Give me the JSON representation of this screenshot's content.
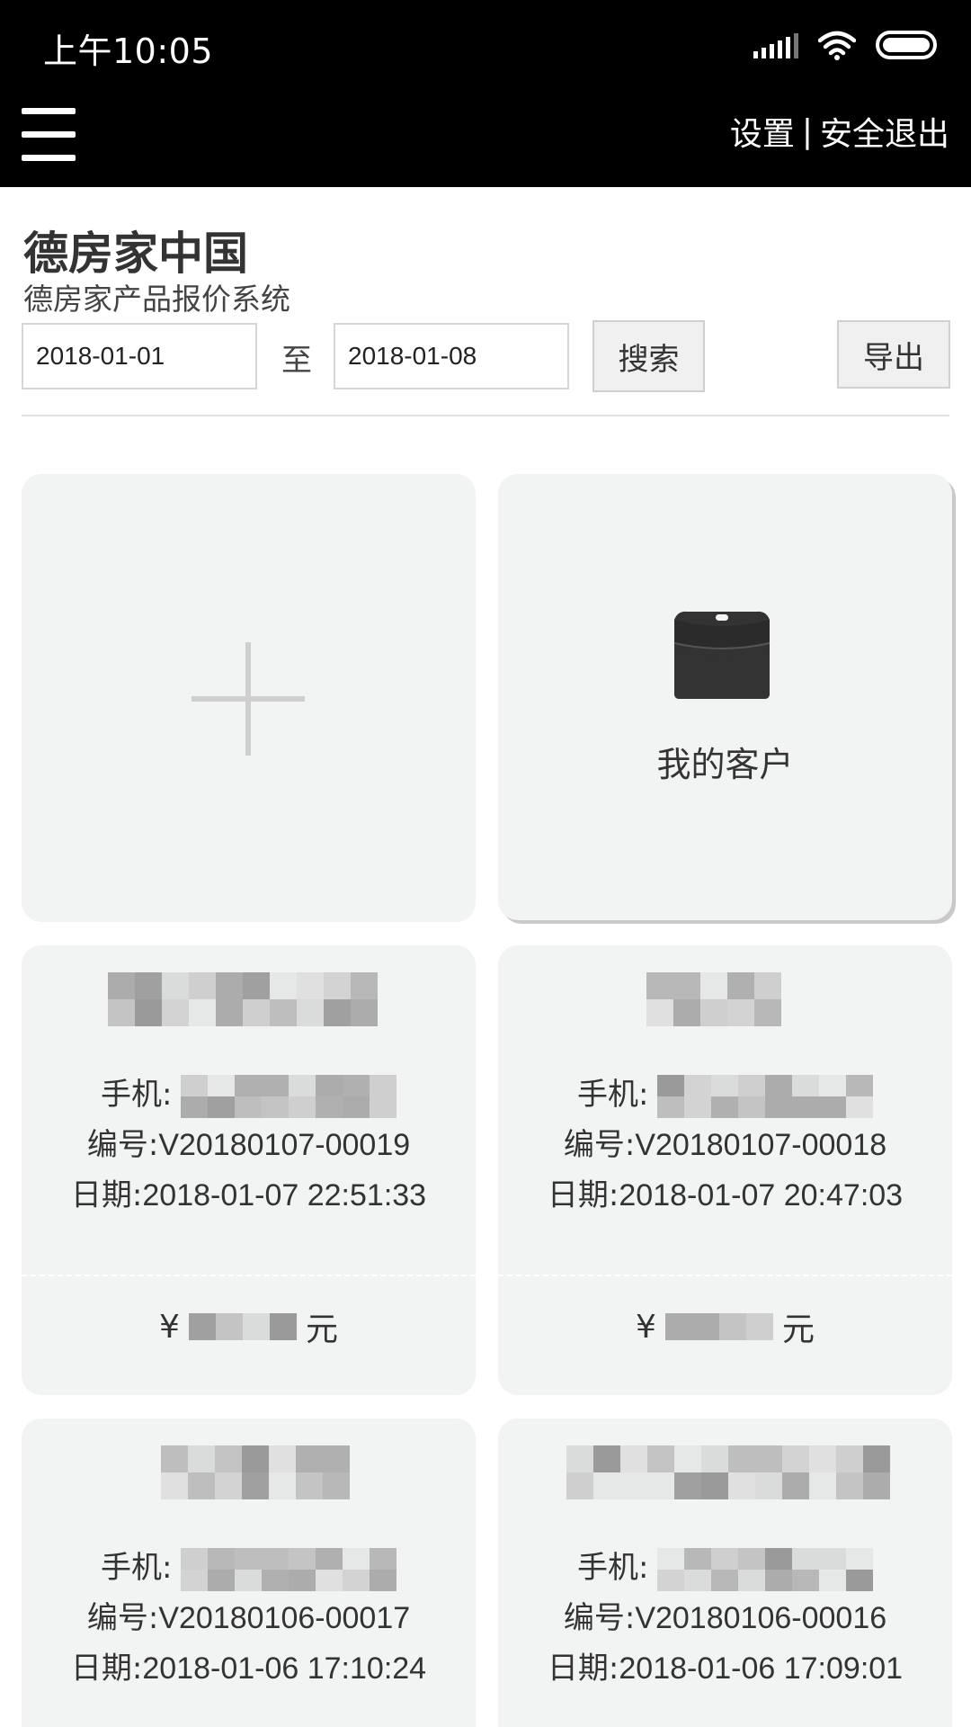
{
  "status_bar": {
    "time": "上午10:05"
  },
  "nav": {
    "settings_label": "设置",
    "separator": "|",
    "logout_label": "安全退出"
  },
  "header": {
    "title": "德房家中国",
    "subtitle": "德房家产品报价系统"
  },
  "filter": {
    "date_from": "2018-01-01",
    "to_label": "至",
    "date_to": "2018-01-08",
    "search_label": "搜索",
    "export_label": "导出"
  },
  "customers_tile": {
    "label": "我的客户",
    "icon": "briefcase-icon"
  },
  "add_tile": {
    "icon": "plus-icon"
  },
  "labels": {
    "phone": "手机:",
    "number": "编号:",
    "date": "日期:",
    "currency": "¥",
    "unit": "元"
  },
  "quotes": [
    {
      "number": "V20180107-00019",
      "date": "2018-01-07 22:51:33"
    },
    {
      "number": "V20180107-00018",
      "date": "2018-01-07 20:47:03"
    },
    {
      "number": "V20180106-00017",
      "date": "2018-01-06 17:10:24"
    },
    {
      "number": "V20180106-00016",
      "date": "2018-01-06 17:09:01"
    }
  ]
}
